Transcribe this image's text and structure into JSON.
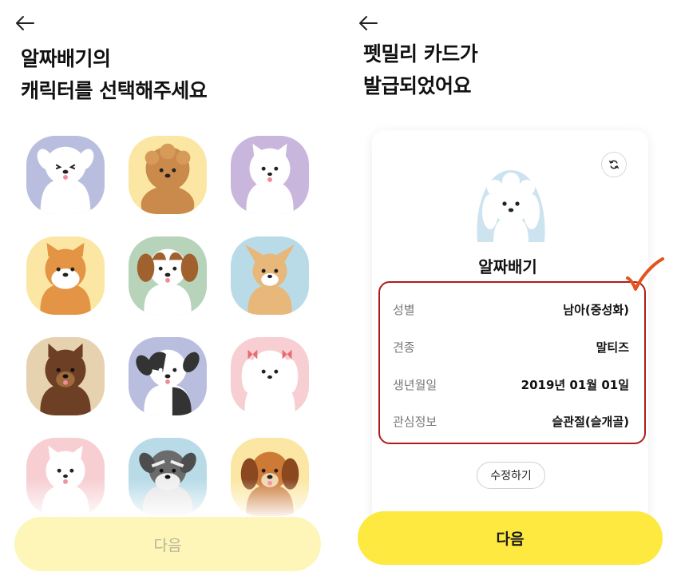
{
  "left_screen": {
    "title_line1": "알짜배기의",
    "title_line2": "캐릭터를 선택해주세요",
    "next_label": "다음",
    "dog_icons": [
      "white-dog-icon",
      "poodle-icon",
      "pomeranian-icon",
      "shiba-icon",
      "cavalier-icon",
      "chihuahua-icon",
      "brown-dog-icon",
      "border-collie-icon",
      "maltese-ribbon-icon",
      "white-fluffy-dog-icon",
      "schnauzer-icon",
      "beagle-icon"
    ]
  },
  "right_screen": {
    "title_line1": "펫밀리 카드가",
    "title_line2": "발급되었어요",
    "pet_name": "알짜배기",
    "info": [
      {
        "label": "성별",
        "value": "남아(중성화)"
      },
      {
        "label": "견종",
        "value": "말티즈"
      },
      {
        "label": "생년월일",
        "value": "2019년 01월 01일"
      },
      {
        "label": "관심정보",
        "value": "슬관절(슬개골)"
      }
    ],
    "edit_label": "수정하기",
    "next_label": "다음",
    "avatar_icon": "maltese-icon"
  },
  "colors": {
    "accent_yellow": "#fde93f",
    "disabled_yellow": "#fdf6b8",
    "highlight_red": "#b11a1a",
    "check_orange": "#e2541b"
  }
}
